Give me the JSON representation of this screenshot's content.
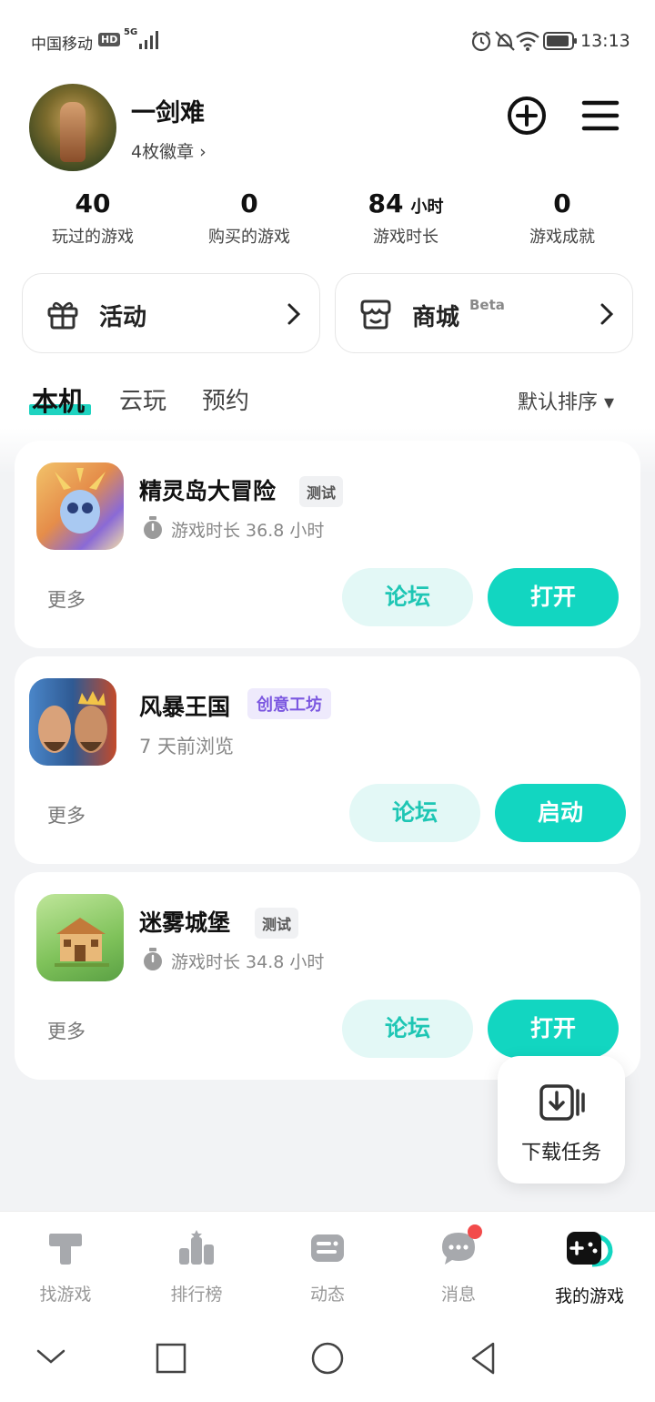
{
  "status_bar": {
    "carrier": "中国移动",
    "hd": "HD",
    "network": "5G",
    "time": "13:13"
  },
  "profile": {
    "username": "一剑难",
    "badges": "4枚徽章 ›"
  },
  "stats": [
    {
      "value": "40",
      "unit": "",
      "label": "玩过的游戏"
    },
    {
      "value": "0",
      "unit": "",
      "label": "购买的游戏"
    },
    {
      "value": "84",
      "unit": "小时",
      "label": "游戏时长"
    },
    {
      "value": "0",
      "unit": "",
      "label": "游戏成就"
    }
  ],
  "shortcuts": {
    "activity": {
      "label": "活动",
      "icon": "gift-icon"
    },
    "store": {
      "label": "商城",
      "beta": "Beta",
      "icon": "store-icon"
    }
  },
  "tabs": [
    "本机",
    "云玩",
    "预约"
  ],
  "sort": {
    "label": "默认排序 ▾"
  },
  "games": [
    {
      "name": "精灵岛大冒险",
      "tag": "测试",
      "meta": "游戏时长 36.8 小时",
      "more": "更多",
      "forum": "论坛",
      "action": "打开"
    },
    {
      "name": "风暴王国",
      "tag": "创意工坊",
      "meta": "7 天前浏览",
      "more": "更多",
      "forum": "论坛",
      "action": "启动"
    },
    {
      "name": "迷雾城堡",
      "tag": "测试",
      "meta": "游戏时长 34.8 小时",
      "more": "更多",
      "forum": "论坛",
      "action": "打开"
    }
  ],
  "floating": {
    "label": "下载任务"
  },
  "bottom_nav": [
    {
      "label": "找游戏",
      "icon": "find-game-icon"
    },
    {
      "label": "排行榜",
      "icon": "ranking-icon"
    },
    {
      "label": "动态",
      "icon": "feed-icon"
    },
    {
      "label": "消息",
      "icon": "message-icon"
    },
    {
      "label": "我的游戏",
      "icon": "my-games-icon"
    }
  ],
  "colors": {
    "accent": "#12d6c1",
    "accent_light": "#e3f8f6",
    "workshop": "#7b57e0"
  }
}
